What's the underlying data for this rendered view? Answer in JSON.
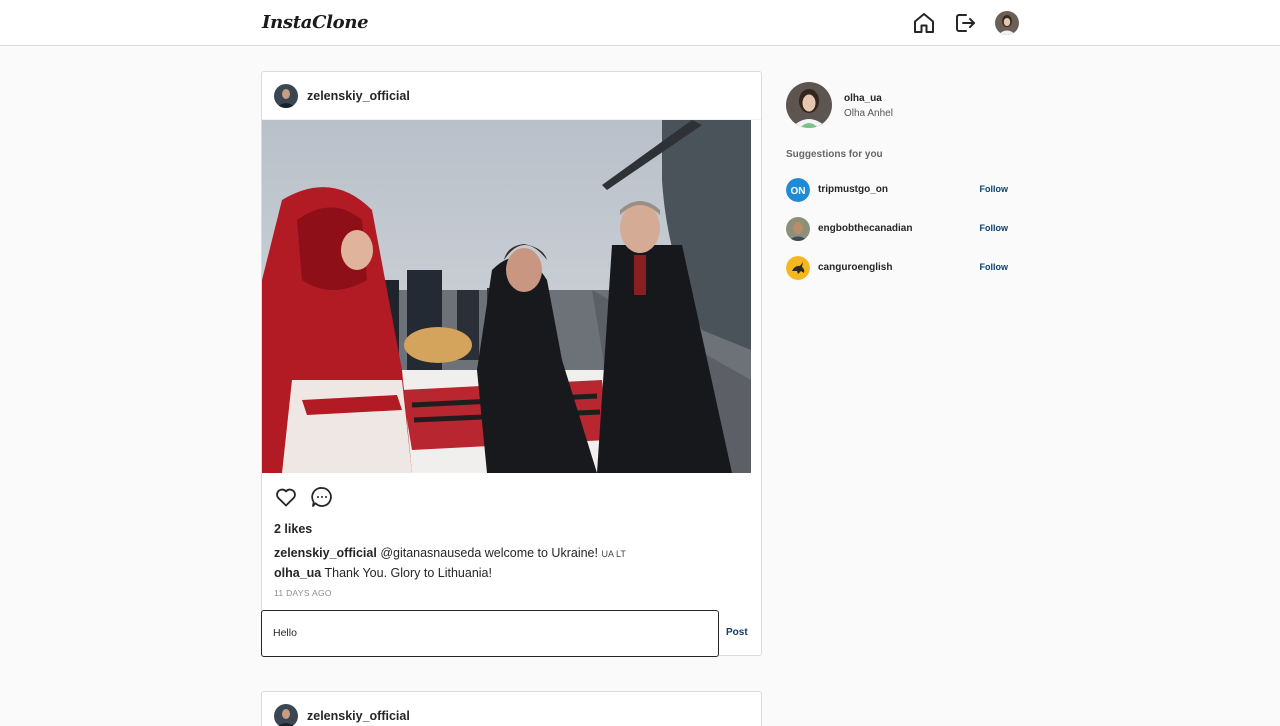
{
  "header": {
    "logo": "InstaClone",
    "icons": [
      "home-icon",
      "logout-icon",
      "avatar"
    ]
  },
  "posts": [
    {
      "username": "zelenskiy_official",
      "likes": "2 likes",
      "comments": [
        {
          "user": "zelenskiy_official",
          "text": "@gitanasnauseda welcome to Ukraine!",
          "flags": "UA LT"
        },
        {
          "user": "olha_ua",
          "text": "Thank You. Glory to Lithuania!"
        }
      ],
      "time": "11 DAYS AGO",
      "comment_input_value": "Hello",
      "post_label": "Post"
    },
    {
      "username": "zelenskiy_official"
    }
  ],
  "sidebar": {
    "me": {
      "username": "olha_ua",
      "full_name": "Olha Anhel"
    },
    "suggestions_title": "Suggestions for you",
    "suggestions": [
      {
        "username": "tripmustgo_on",
        "action": "Follow"
      },
      {
        "username": "engbobthecanadian",
        "action": "Follow"
      },
      {
        "username": "canguroenglish",
        "action": "Follow"
      }
    ]
  },
  "colors": {
    "link": "#0a3f6e",
    "border": "#dbdbdb",
    "background": "#fafafa"
  }
}
